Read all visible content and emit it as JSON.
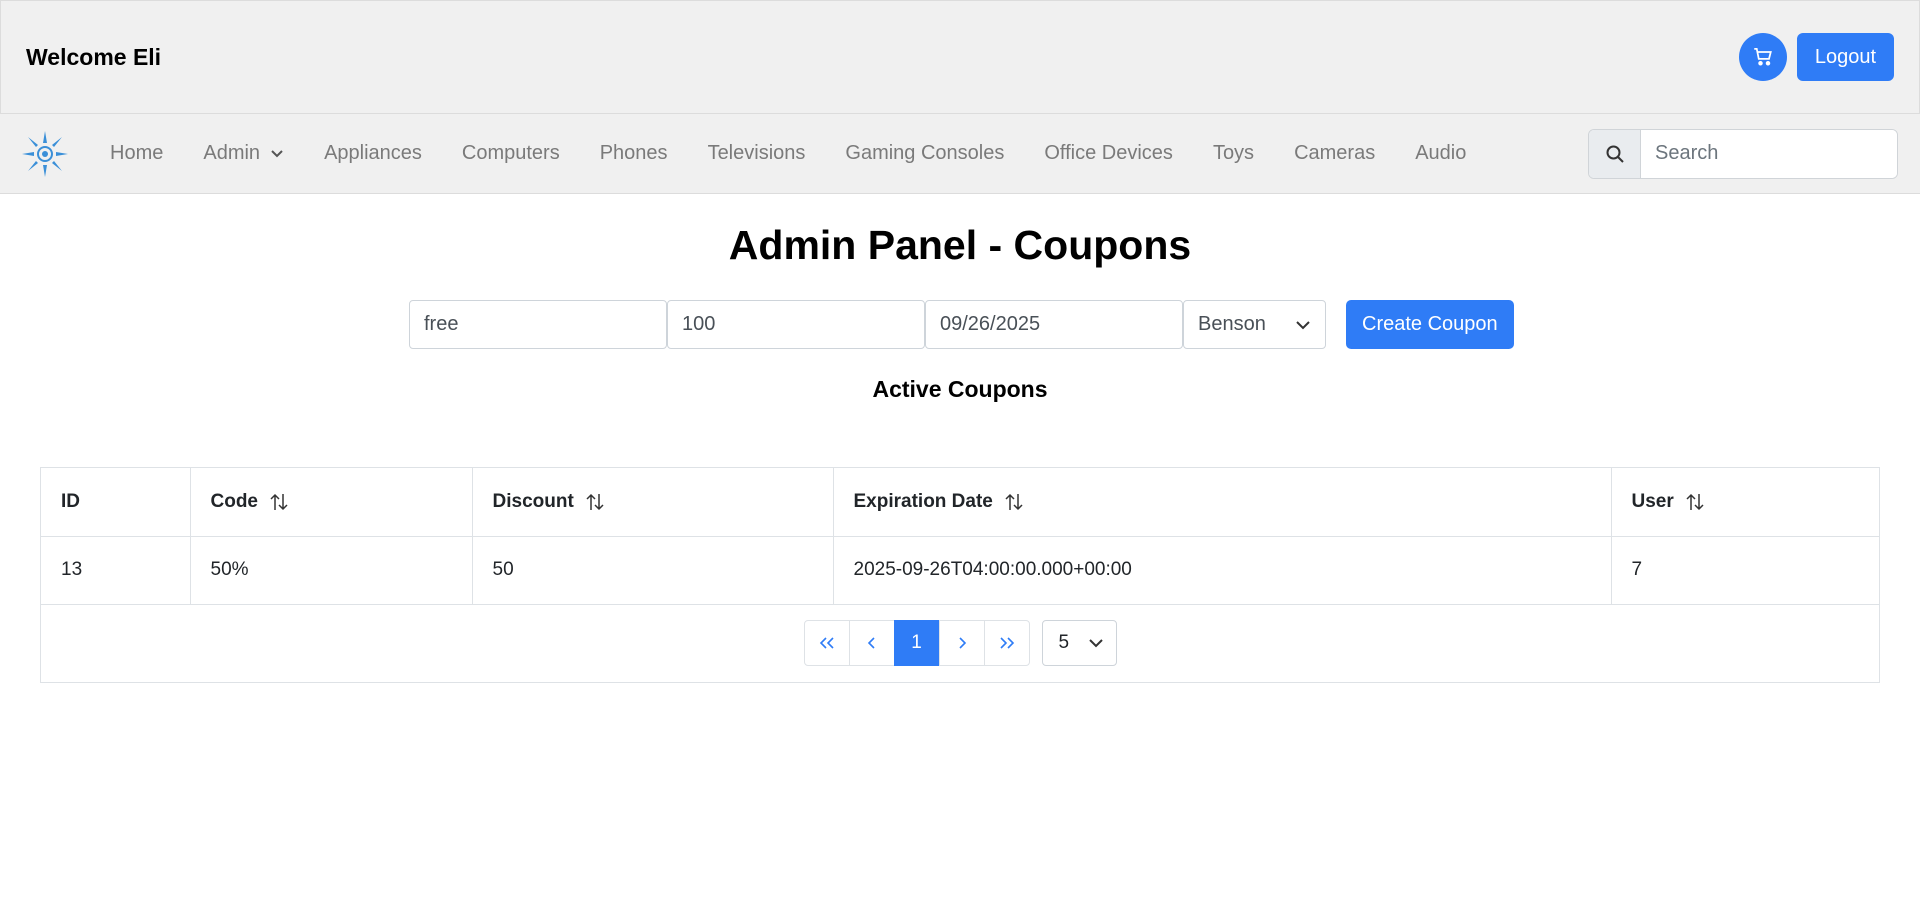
{
  "header": {
    "welcome": "Welcome Eli",
    "logout_label": "Logout",
    "cart_icon": "cart-icon"
  },
  "nav": {
    "items": [
      {
        "label": "Home"
      },
      {
        "label": "Admin",
        "dropdown": true
      },
      {
        "label": "Appliances"
      },
      {
        "label": "Computers"
      },
      {
        "label": "Phones"
      },
      {
        "label": "Televisions"
      },
      {
        "label": "Gaming Consoles"
      },
      {
        "label": "Office Devices"
      },
      {
        "label": "Toys"
      },
      {
        "label": "Cameras"
      },
      {
        "label": "Audio"
      }
    ],
    "search_placeholder": "Search"
  },
  "main": {
    "title": "Admin Panel - Coupons",
    "form": {
      "code_value": "free",
      "discount_value": "100",
      "date_value": "09/26/2025",
      "user_selected": "Benson",
      "create_label": "Create Coupon"
    },
    "subtitle": "Active Coupons"
  },
  "table": {
    "headers": [
      "ID",
      "Code",
      "Discount",
      "Expiration Date",
      "User"
    ],
    "rows": [
      [
        "13",
        "50%",
        "50",
        "2025-09-26T04:00:00.000+00:00",
        "7"
      ]
    ]
  },
  "pagination": {
    "current_page": "1",
    "page_size": "5"
  },
  "colors": {
    "accent": "#2f7cf6",
    "header_bg": "#f0f0f0"
  }
}
